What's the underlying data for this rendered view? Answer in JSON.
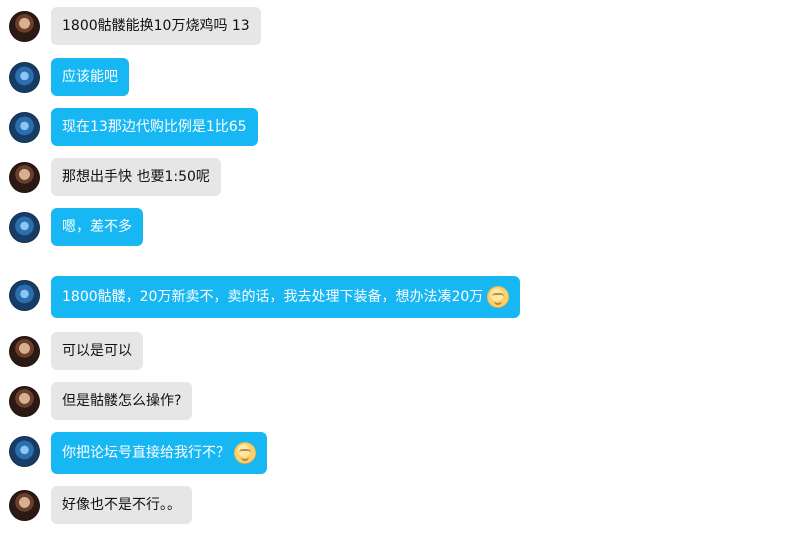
{
  "messages": [
    {
      "side": "left",
      "color": "gray",
      "avatar": "avatar-a",
      "text": "1800骷髅能换10万烧鸡吗 13"
    },
    {
      "side": "left",
      "color": "blue",
      "avatar": "avatar-b",
      "text": "应该能吧"
    },
    {
      "side": "left",
      "color": "blue",
      "avatar": "avatar-b",
      "text": "现在13那边代购比例是1比65"
    },
    {
      "side": "left",
      "color": "gray",
      "avatar": "avatar-a",
      "text": "那想出手快 也要1:50呢"
    },
    {
      "side": "left",
      "color": "blue",
      "avatar": "avatar-b",
      "text": "嗯，差不多"
    },
    {
      "side": "left",
      "color": "blue",
      "avatar": "avatar-b",
      "text": "1800骷髅，20万新卖不，卖的话，我去处理下装备，想办法凑20万",
      "emoji": "smile-emoji"
    },
    {
      "side": "left",
      "color": "gray",
      "avatar": "avatar-a",
      "text": "可以是可以"
    },
    {
      "side": "left",
      "color": "gray",
      "avatar": "avatar-a",
      "text": "但是骷髅怎么操作?"
    },
    {
      "side": "left",
      "color": "blue",
      "avatar": "avatar-b",
      "text": "你把论坛号直接给我行不？",
      "emoji": "smile-emoji"
    },
    {
      "side": "left",
      "color": "gray",
      "avatar": "avatar-a",
      "text": "好像也不是不行。。"
    }
  ]
}
